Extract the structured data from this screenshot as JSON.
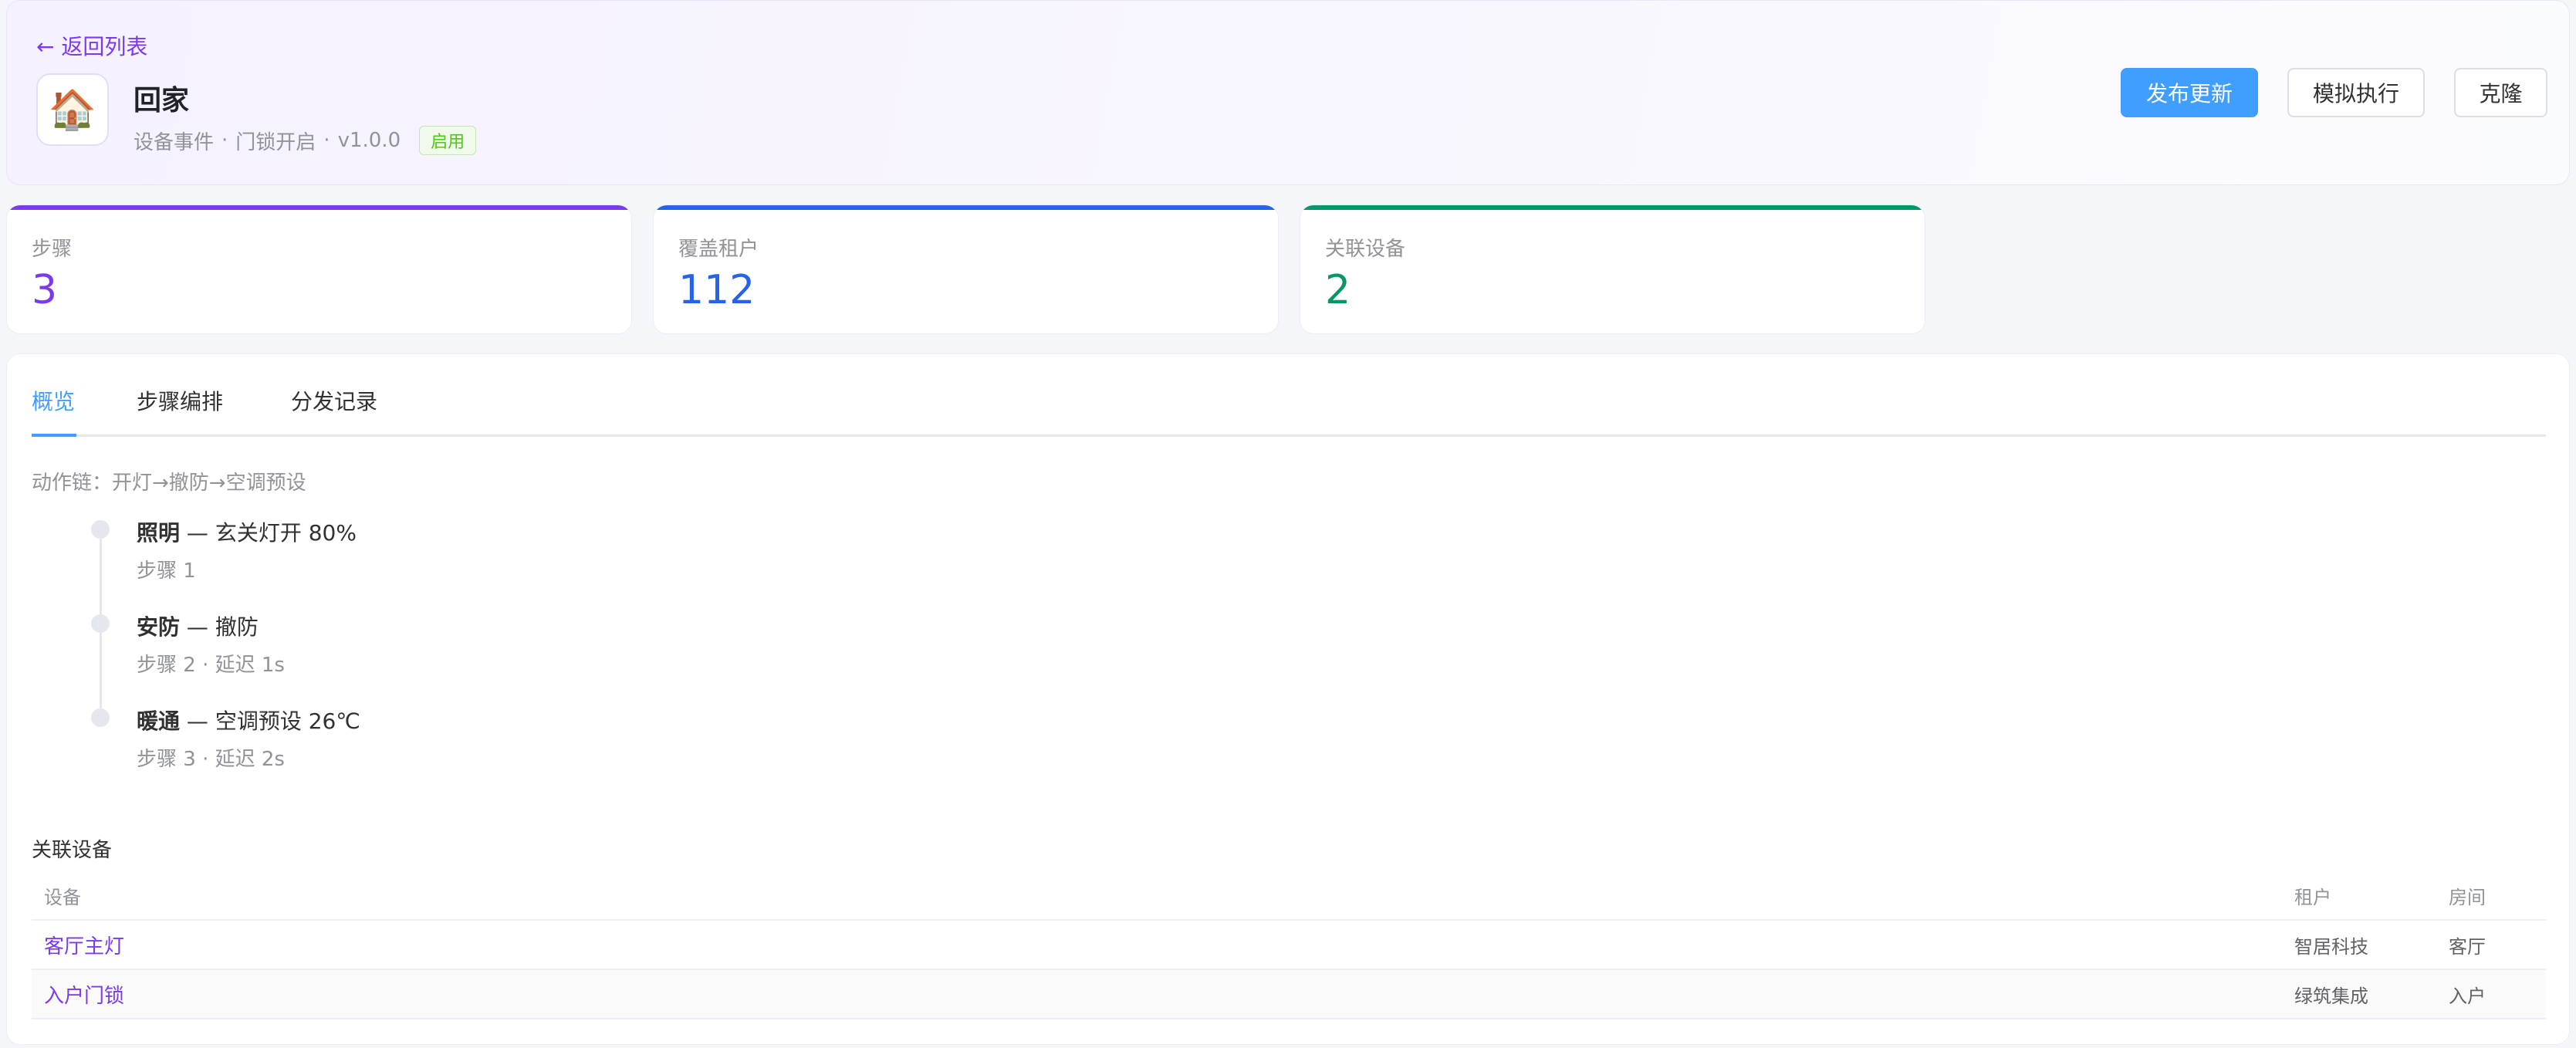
{
  "header": {
    "back_label": "← 返回列表",
    "icon": "🏠",
    "title": "回家",
    "meta": [
      "设备事件",
      "门锁开启",
      "v1.0.0"
    ],
    "separator": "·",
    "status": "启用",
    "buttons": {
      "publish": "发布更新",
      "simulate": "模拟执行",
      "clone": "克隆"
    }
  },
  "stats": [
    {
      "label": "步骤",
      "value": "3",
      "color": "#7c3aed"
    },
    {
      "label": "覆盖租户",
      "value": "112",
      "color": "#2563eb"
    },
    {
      "label": "关联设备",
      "value": "2",
      "color": "#059669"
    }
  ],
  "tabs": [
    "概览",
    "步骤编排",
    "分发记录"
  ],
  "overview": {
    "chain": "动作链：开灯→撤防→空调预设",
    "steps": [
      {
        "category": "照明",
        "action": " — 玄关灯开 80%",
        "sub": "步骤 1"
      },
      {
        "category": "安防",
        "action": " — 撤防",
        "sub": "步骤 2 · 延迟 1s"
      },
      {
        "category": "暖通",
        "action": " — 空调预设 26℃",
        "sub": "步骤 3 · 延迟 2s"
      }
    ],
    "devices_title": "关联设备",
    "columns": [
      "设备",
      "租户",
      "房间"
    ],
    "rows": [
      [
        "客厅主灯",
        "智居科技",
        "客厅"
      ],
      [
        "入户门锁",
        "绿筑集成",
        "入户"
      ]
    ]
  }
}
